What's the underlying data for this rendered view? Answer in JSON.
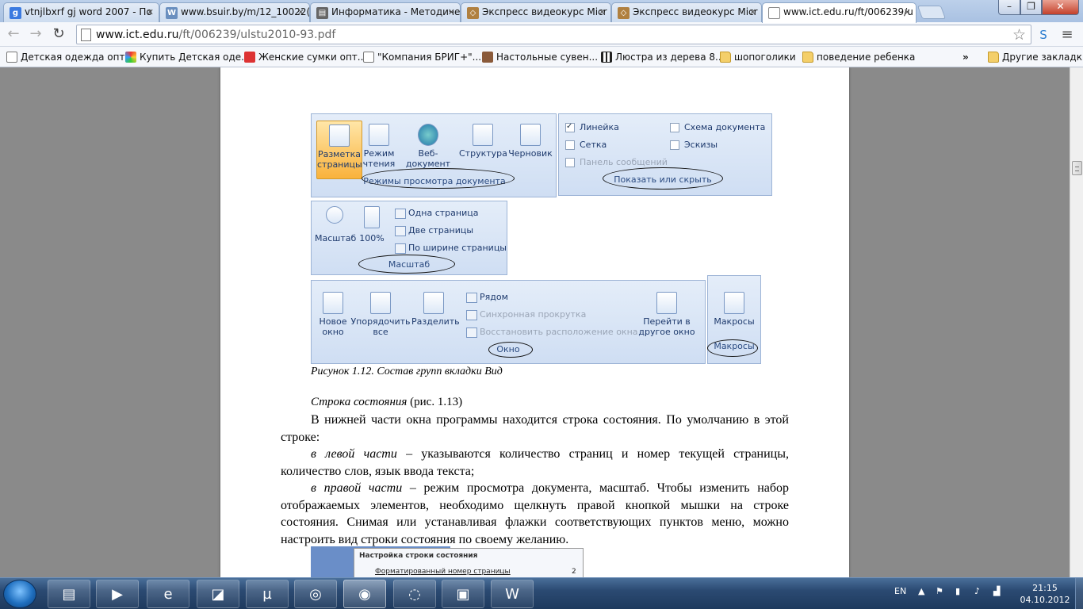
{
  "browser": {
    "tabs": [
      {
        "title": "vtnjlbxrf gj word 2007 - По",
        "favicon": "google-icon",
        "color": "#3b7ae0"
      },
      {
        "title": "www.bsuir.by/m/12_10022(",
        "favicon": "page-icon",
        "color": "#6a8fbf"
      },
      {
        "title": "Информатика - Методиче",
        "favicon": "printer-icon",
        "color": "#666"
      },
      {
        "title": "Экспресс видеокурс Micr",
        "favicon": "diamond-icon",
        "color": "#b08040"
      },
      {
        "title": "Экспресс видеокурс Micr",
        "favicon": "diamond-icon",
        "color": "#b08040"
      },
      {
        "title": "www.ict.edu.ru/ft/006239/u",
        "favicon": "page-icon",
        "color": "#888"
      }
    ],
    "url_host": "www.ict.edu.ru",
    "url_path": "/ft/006239/ulstu2010-93.pdf",
    "bookmarks": [
      {
        "label": "Детская одежда опт...",
        "icon": "page-icon"
      },
      {
        "label": "Купить Детская оде...",
        "icon": "colorful-icon"
      },
      {
        "label": "Женские сумки опт...",
        "icon": "warning-icon"
      },
      {
        "label": "\"Компания БРИГ+\"...",
        "icon": "page-icon"
      },
      {
        "label": "Настольные сувен...",
        "icon": "brown-icon"
      },
      {
        "label": "Люстра из дерева 8...",
        "icon": "grid-icon"
      },
      {
        "label": "шопоголики",
        "icon": "folder-icon"
      },
      {
        "label": "поведение ребенка",
        "icon": "folder-icon"
      },
      {
        "label": "Другие закладки",
        "icon": "folder-icon"
      }
    ],
    "more_bookmarks": "»"
  },
  "figure": {
    "views_group": {
      "items": [
        "Разметка страницы",
        "Режим чтения",
        "Веб-документ",
        "Структура",
        "Черновик"
      ],
      "label": "Режимы просмотра документа"
    },
    "show_group": {
      "items": [
        "Линейка",
        "Сетка",
        "Панель сообщений",
        "Схема документа",
        "Эскизы"
      ],
      "label": "Показать или скрыть"
    },
    "zoom_group": {
      "big": [
        "Масштаб",
        "100%"
      ],
      "small": [
        "Одна страница",
        "Две страницы",
        "По ширине страницы"
      ],
      "label": "Масштаб"
    },
    "window_group": {
      "big": [
        "Новое окно",
        "Упорядочить все",
        "Разделить"
      ],
      "small": [
        "Рядом",
        "Синхронная прокрутка",
        "Восстановить расположение окна"
      ],
      "switch": "Перейти в другое окно",
      "label": "Окно"
    },
    "macros_group": {
      "button": "Макросы",
      "label": "Макросы"
    },
    "caption": "Рисунок 1.12. Состав групп вкладки Вид"
  },
  "text": {
    "heading_italic": "Строка состояния",
    "heading_rest": " (рис. 1.13)",
    "p1": "В нижней части окна программы находится строка состояния. По умолчанию в этой строке:",
    "p2_italic": "в левой части",
    "p2_rest": " – указываются количество страниц и номер текущей страницы, количество слов, язык ввода текста;",
    "p3_italic": "в правой части",
    "p3_rest": " – режим просмотра документа, масштаб. Чтобы изменить набор отображаемых элементов, необходимо щелкнуть правой кнопкой мышки на строке состояния. Снимая или устанавливая флажки соответствующих пунктов меню, можно настроить вид строки состояния по своему желанию."
  },
  "figure2": {
    "menu_title": "Настройка строки состояния",
    "item": "Форматированный номер страницы",
    "item_value": "2"
  },
  "taskbar": {
    "lang": "EN",
    "time": "21:15",
    "date": "04.10.2012"
  }
}
